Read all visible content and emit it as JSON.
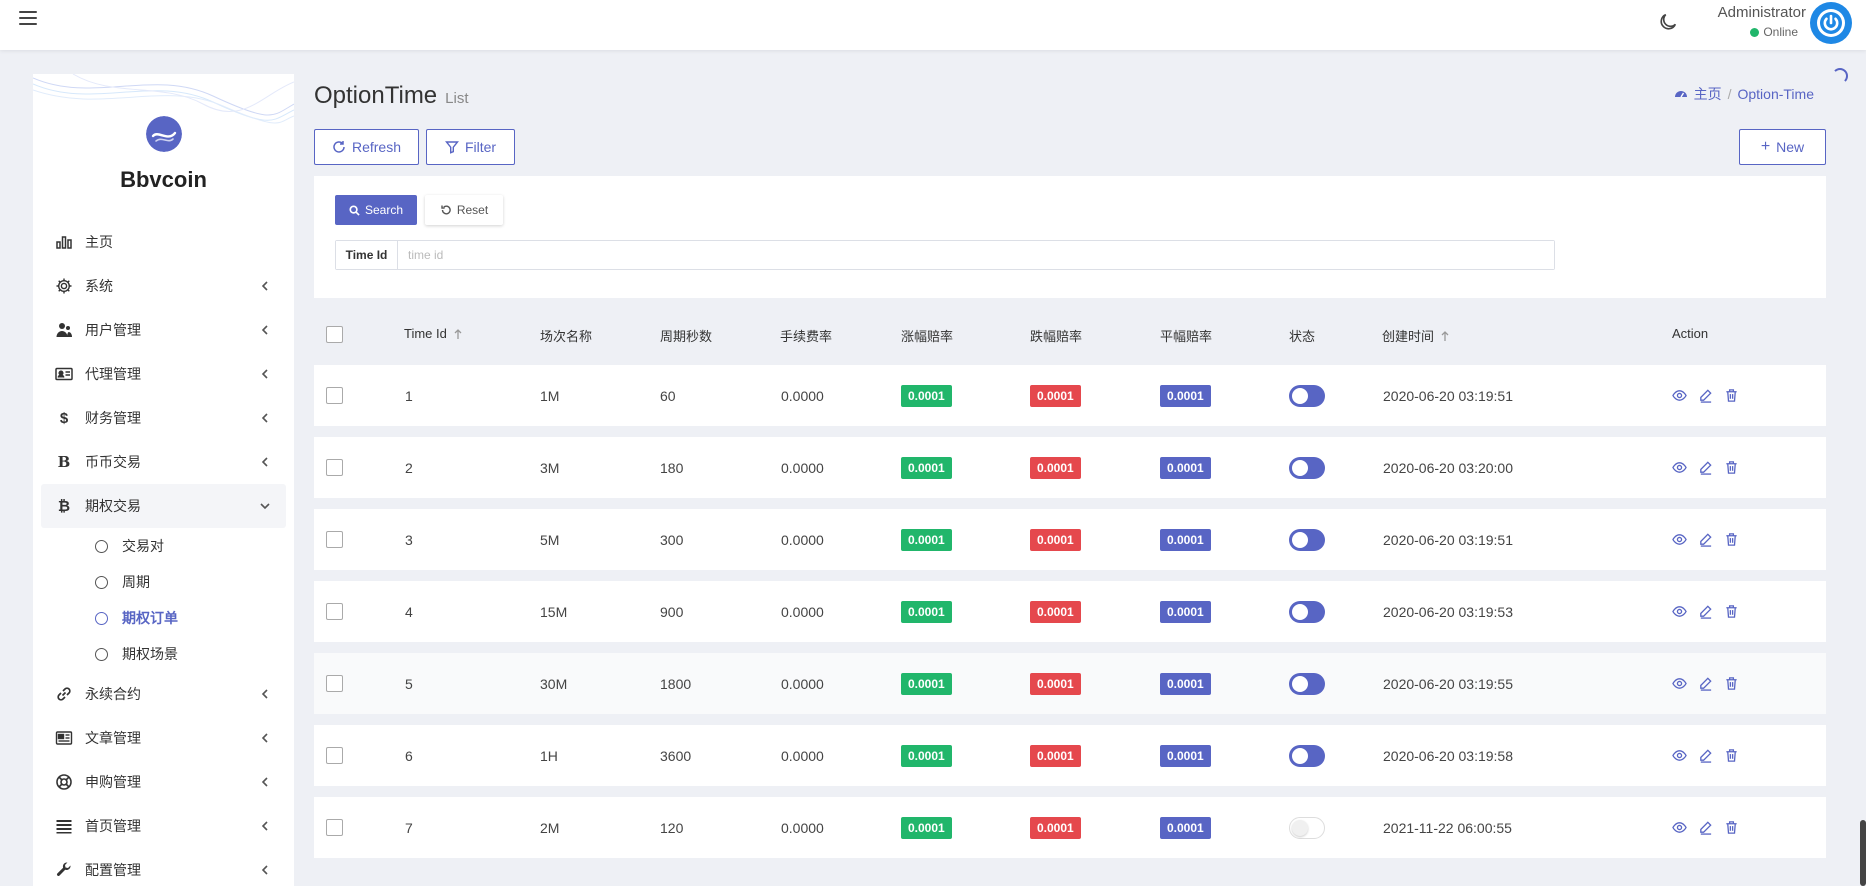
{
  "header": {
    "user_name": "Administrator",
    "user_status": "Online"
  },
  "sidebar": {
    "brand": "Bbvcoin",
    "items": [
      {
        "label": "主页",
        "icon": "bar-chart-icon",
        "chevron": false
      },
      {
        "label": "系统",
        "icon": "gear-icon",
        "chevron": true
      },
      {
        "label": "用户管理",
        "icon": "users-icon",
        "chevron": true
      },
      {
        "label": "代理管理",
        "icon": "id-card-icon",
        "chevron": true
      },
      {
        "label": "财务管理",
        "icon": "dollar-icon",
        "chevron": true
      },
      {
        "label": "币币交易",
        "icon": "bold-b-icon",
        "chevron": true
      },
      {
        "label": "期权交易",
        "icon": "bitcoin-icon",
        "chevron": true,
        "expanded": true
      }
    ],
    "subitems": [
      {
        "label": "交易对"
      },
      {
        "label": "周期"
      },
      {
        "label": "期权订单",
        "current": true
      },
      {
        "label": "期权场景"
      }
    ],
    "items_after": [
      {
        "label": "永续合约",
        "icon": "link-icon"
      },
      {
        "label": "文章管理",
        "icon": "newspaper-icon"
      },
      {
        "label": "申购管理",
        "icon": "lifebuoy-icon"
      },
      {
        "label": "首页管理",
        "icon": "list-icon"
      },
      {
        "label": "配置管理",
        "icon": "wrench-icon"
      }
    ]
  },
  "page": {
    "title": "OptionTime",
    "subtitle": "List",
    "breadcrumb_home": "主页",
    "breadcrumb_current": "Option-Time"
  },
  "toolbar": {
    "refresh_label": "Refresh",
    "filter_label": "Filter",
    "new_label": "New"
  },
  "filter": {
    "search_label": "Search",
    "reset_label": "Reset",
    "field_label": "Time Id",
    "field_placeholder": "time id"
  },
  "table": {
    "columns": [
      "Time Id",
      "场次名称",
      "周期秒数",
      "手续费率",
      "涨幅赔率",
      "跌幅赔率",
      "平幅赔率",
      "状态",
      "创建时间",
      "Action"
    ],
    "rows": [
      {
        "id": "1",
        "name": "1M",
        "seconds": "60",
        "fee": "0.0000",
        "up": "0.0001",
        "down": "0.0001",
        "flat": "0.0001",
        "status": true,
        "created": "2020-06-20 03:19:51"
      },
      {
        "id": "2",
        "name": "3M",
        "seconds": "180",
        "fee": "0.0000",
        "up": "0.0001",
        "down": "0.0001",
        "flat": "0.0001",
        "status": true,
        "created": "2020-06-20 03:20:00"
      },
      {
        "id": "3",
        "name": "5M",
        "seconds": "300",
        "fee": "0.0000",
        "up": "0.0001",
        "down": "0.0001",
        "flat": "0.0001",
        "status": true,
        "created": "2020-06-20 03:19:51"
      },
      {
        "id": "4",
        "name": "15M",
        "seconds": "900",
        "fee": "0.0000",
        "up": "0.0001",
        "down": "0.0001",
        "flat": "0.0001",
        "status": true,
        "created": "2020-06-20 03:19:53"
      },
      {
        "id": "5",
        "name": "30M",
        "seconds": "1800",
        "fee": "0.0000",
        "up": "0.0001",
        "down": "0.0001",
        "flat": "0.0001",
        "status": true,
        "created": "2020-06-20 03:19:55"
      },
      {
        "id": "6",
        "name": "1H",
        "seconds": "3600",
        "fee": "0.0000",
        "up": "0.0001",
        "down": "0.0001",
        "flat": "0.0001",
        "status": true,
        "created": "2020-06-20 03:19:58"
      },
      {
        "id": "7",
        "name": "2M",
        "seconds": "120",
        "fee": "0.0000",
        "up": "0.0001",
        "down": "0.0001",
        "flat": "0.0001",
        "status": false,
        "created": "2021-11-22 06:00:55"
      }
    ]
  },
  "colors": {
    "accent": "#5865c4",
    "green": "#21b66b",
    "red": "#e5484d"
  }
}
